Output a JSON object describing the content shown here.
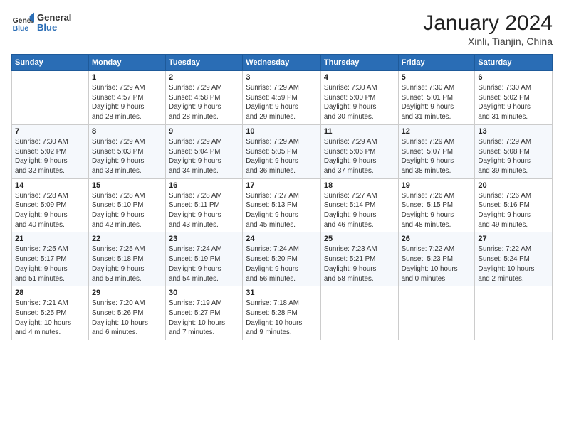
{
  "header": {
    "logo_general": "General",
    "logo_blue": "Blue",
    "month_title": "January 2024",
    "location": "Xinli, Tianjin, China"
  },
  "columns": [
    "Sunday",
    "Monday",
    "Tuesday",
    "Wednesday",
    "Thursday",
    "Friday",
    "Saturday"
  ],
  "weeks": [
    [
      {
        "day": "",
        "info": ""
      },
      {
        "day": "1",
        "info": "Sunrise: 7:29 AM\nSunset: 4:57 PM\nDaylight: 9 hours\nand 28 minutes."
      },
      {
        "day": "2",
        "info": "Sunrise: 7:29 AM\nSunset: 4:58 PM\nDaylight: 9 hours\nand 28 minutes."
      },
      {
        "day": "3",
        "info": "Sunrise: 7:29 AM\nSunset: 4:59 PM\nDaylight: 9 hours\nand 29 minutes."
      },
      {
        "day": "4",
        "info": "Sunrise: 7:30 AM\nSunset: 5:00 PM\nDaylight: 9 hours\nand 30 minutes."
      },
      {
        "day": "5",
        "info": "Sunrise: 7:30 AM\nSunset: 5:01 PM\nDaylight: 9 hours\nand 31 minutes."
      },
      {
        "day": "6",
        "info": "Sunrise: 7:30 AM\nSunset: 5:02 PM\nDaylight: 9 hours\nand 31 minutes."
      }
    ],
    [
      {
        "day": "7",
        "info": "Sunrise: 7:30 AM\nSunset: 5:02 PM\nDaylight: 9 hours\nand 32 minutes."
      },
      {
        "day": "8",
        "info": "Sunrise: 7:29 AM\nSunset: 5:03 PM\nDaylight: 9 hours\nand 33 minutes."
      },
      {
        "day": "9",
        "info": "Sunrise: 7:29 AM\nSunset: 5:04 PM\nDaylight: 9 hours\nand 34 minutes."
      },
      {
        "day": "10",
        "info": "Sunrise: 7:29 AM\nSunset: 5:05 PM\nDaylight: 9 hours\nand 36 minutes."
      },
      {
        "day": "11",
        "info": "Sunrise: 7:29 AM\nSunset: 5:06 PM\nDaylight: 9 hours\nand 37 minutes."
      },
      {
        "day": "12",
        "info": "Sunrise: 7:29 AM\nSunset: 5:07 PM\nDaylight: 9 hours\nand 38 minutes."
      },
      {
        "day": "13",
        "info": "Sunrise: 7:29 AM\nSunset: 5:08 PM\nDaylight: 9 hours\nand 39 minutes."
      }
    ],
    [
      {
        "day": "14",
        "info": "Sunrise: 7:28 AM\nSunset: 5:09 PM\nDaylight: 9 hours\nand 40 minutes."
      },
      {
        "day": "15",
        "info": "Sunrise: 7:28 AM\nSunset: 5:10 PM\nDaylight: 9 hours\nand 42 minutes."
      },
      {
        "day": "16",
        "info": "Sunrise: 7:28 AM\nSunset: 5:11 PM\nDaylight: 9 hours\nand 43 minutes."
      },
      {
        "day": "17",
        "info": "Sunrise: 7:27 AM\nSunset: 5:13 PM\nDaylight: 9 hours\nand 45 minutes."
      },
      {
        "day": "18",
        "info": "Sunrise: 7:27 AM\nSunset: 5:14 PM\nDaylight: 9 hours\nand 46 minutes."
      },
      {
        "day": "19",
        "info": "Sunrise: 7:26 AM\nSunset: 5:15 PM\nDaylight: 9 hours\nand 48 minutes."
      },
      {
        "day": "20",
        "info": "Sunrise: 7:26 AM\nSunset: 5:16 PM\nDaylight: 9 hours\nand 49 minutes."
      }
    ],
    [
      {
        "day": "21",
        "info": "Sunrise: 7:25 AM\nSunset: 5:17 PM\nDaylight: 9 hours\nand 51 minutes."
      },
      {
        "day": "22",
        "info": "Sunrise: 7:25 AM\nSunset: 5:18 PM\nDaylight: 9 hours\nand 53 minutes."
      },
      {
        "day": "23",
        "info": "Sunrise: 7:24 AM\nSunset: 5:19 PM\nDaylight: 9 hours\nand 54 minutes."
      },
      {
        "day": "24",
        "info": "Sunrise: 7:24 AM\nSunset: 5:20 PM\nDaylight: 9 hours\nand 56 minutes."
      },
      {
        "day": "25",
        "info": "Sunrise: 7:23 AM\nSunset: 5:21 PM\nDaylight: 9 hours\nand 58 minutes."
      },
      {
        "day": "26",
        "info": "Sunrise: 7:22 AM\nSunset: 5:23 PM\nDaylight: 10 hours\nand 0 minutes."
      },
      {
        "day": "27",
        "info": "Sunrise: 7:22 AM\nSunset: 5:24 PM\nDaylight: 10 hours\nand 2 minutes."
      }
    ],
    [
      {
        "day": "28",
        "info": "Sunrise: 7:21 AM\nSunset: 5:25 PM\nDaylight: 10 hours\nand 4 minutes."
      },
      {
        "day": "29",
        "info": "Sunrise: 7:20 AM\nSunset: 5:26 PM\nDaylight: 10 hours\nand 6 minutes."
      },
      {
        "day": "30",
        "info": "Sunrise: 7:19 AM\nSunset: 5:27 PM\nDaylight: 10 hours\nand 7 minutes."
      },
      {
        "day": "31",
        "info": "Sunrise: 7:18 AM\nSunset: 5:28 PM\nDaylight: 10 hours\nand 9 minutes."
      },
      {
        "day": "",
        "info": ""
      },
      {
        "day": "",
        "info": ""
      },
      {
        "day": "",
        "info": ""
      }
    ]
  ]
}
